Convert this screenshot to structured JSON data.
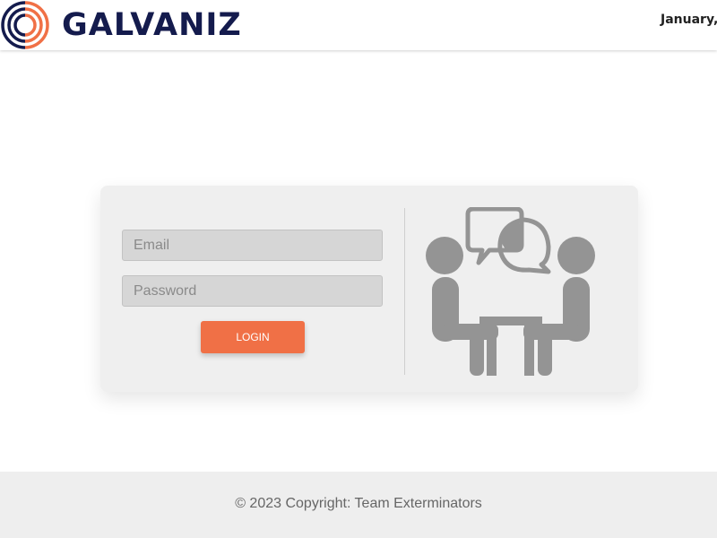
{
  "header": {
    "logo_text": "GALVANIZ",
    "date_text": "January,"
  },
  "login": {
    "email_placeholder": "Email",
    "password_placeholder": "Password",
    "login_button_label": "LOGIN"
  },
  "illustration": {
    "icon": "people-meeting-icon"
  },
  "footer": {
    "copyright": "© 2023 Copyright: Team Exterminators"
  },
  "colors": {
    "brand_navy": "#141b4d",
    "accent_orange": "#f07046",
    "card_background": "#efefef",
    "icon_gray": "#949494"
  }
}
